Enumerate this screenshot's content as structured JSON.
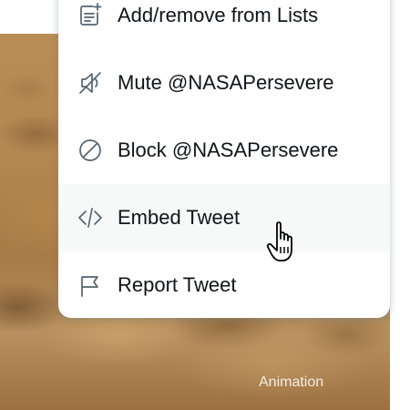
{
  "menu": {
    "items": [
      {
        "label": "Add/remove from Lists",
        "icon": "list-add-icon"
      },
      {
        "label": "Mute @NASAPersevere",
        "icon": "mute-speaker-icon"
      },
      {
        "label": "Block @NASAPersevere",
        "icon": "block-icon"
      },
      {
        "label": "Embed Tweet",
        "icon": "code-embed-icon"
      },
      {
        "label": "Report Tweet",
        "icon": "flag-icon"
      }
    ]
  },
  "media": {
    "badge": "Animation"
  },
  "colors": {
    "text": "#0f1419",
    "icon": "#536471",
    "hover_bg": "#f7f9f9"
  }
}
